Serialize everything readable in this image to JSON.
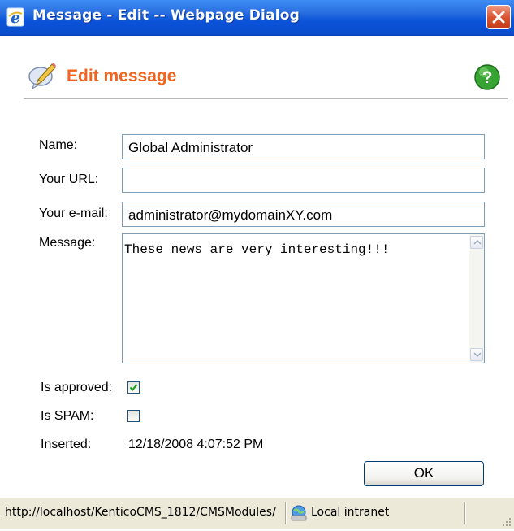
{
  "window": {
    "title": "Message - Edit -- Webpage Dialog",
    "close_icon": "close-x-icon",
    "app_icon": "internet-explorer-icon"
  },
  "header": {
    "title": "Edit message",
    "icon": "edit-message-icon",
    "help_icon": "help-question-icon"
  },
  "form": {
    "name": {
      "label": "Name:",
      "value": "Global Administrator"
    },
    "url": {
      "label": "Your URL:",
      "value": ""
    },
    "email": {
      "label": "Your e-mail:",
      "value": "administrator@mydomainXY.com"
    },
    "message": {
      "label": "Message:",
      "value": "These news are very interesting!!!"
    },
    "approved": {
      "label": "Is approved:",
      "checked": true
    },
    "spam": {
      "label": "Is SPAM:",
      "checked": false
    },
    "inserted": {
      "label": "Inserted:",
      "value": "12/18/2008 4:07:52 PM"
    },
    "ok_label": "OK"
  },
  "statusbar": {
    "url": "http://localhost/KenticoCMS_1812/CMSModules/",
    "zone": "Local intranet",
    "zone_icon": "local-intranet-icon"
  },
  "colors": {
    "accent": "#f0641e",
    "titlebar": "#0b53d8",
    "checkmark": "#21a121"
  }
}
